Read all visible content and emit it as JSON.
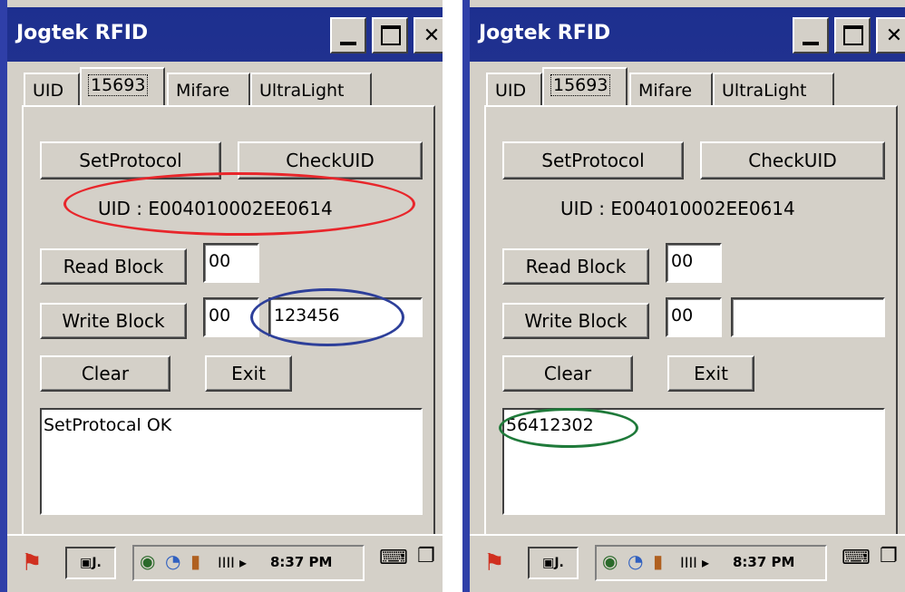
{
  "screens": [
    {
      "title": "Jogtek RFID",
      "tabs": [
        "UID",
        "15693",
        "Mifare",
        "UltraLight"
      ],
      "set_protocol_label": "SetProtocol",
      "check_uid_label": "CheckUID",
      "uid_text": "UID : E004010002EE0614",
      "read_block_label": "Read Block",
      "read_block_value": "00",
      "write_block_label": "Write Block",
      "write_block_addr": "00",
      "write_block_data": "123456",
      "clear_label": "Clear",
      "exit_label": "Exit",
      "output_text": "SetProtocal OK",
      "clock": "8:37 PM",
      "highlight_colors": {
        "uid": "#e8262b",
        "data": "#2d3f9a"
      }
    },
    {
      "title": "Jogtek RFID",
      "tabs": [
        "UID",
        "15693",
        "Mifare",
        "UltraLight"
      ],
      "set_protocol_label": "SetProtocol",
      "check_uid_label": "CheckUID",
      "uid_text": "UID : E004010002EE0614",
      "read_block_label": "Read Block",
      "read_block_value": "00",
      "write_block_label": "Write Block",
      "write_block_addr": "00",
      "write_block_data": "",
      "clear_label": "Clear",
      "exit_label": "Exit",
      "output_text": "56412302",
      "clock": "8:37 PM",
      "highlight_colors": {
        "output": "#1f7a3a"
      }
    }
  ],
  "icons": {
    "start": "windows-flag-icon",
    "keyboard": "keyboard-icon",
    "desktop": "desktop-switch-icon"
  }
}
